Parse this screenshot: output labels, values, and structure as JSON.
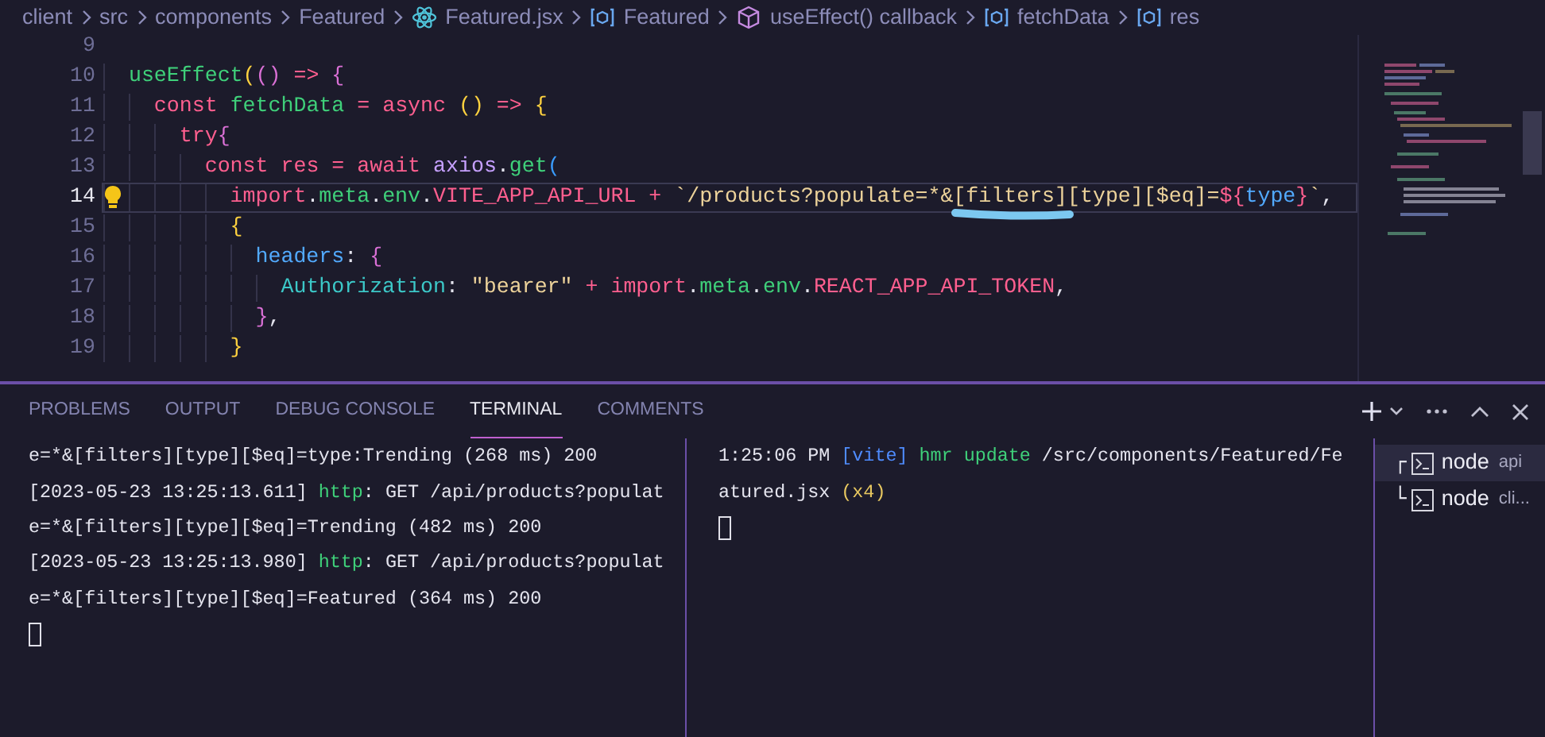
{
  "breadcrumb": [
    {
      "text": "client",
      "kind": "folder"
    },
    {
      "text": "src",
      "kind": "folder"
    },
    {
      "text": "components",
      "kind": "folder"
    },
    {
      "text": "Featured",
      "kind": "folder"
    },
    {
      "text": "Featured.jsx",
      "kind": "react"
    },
    {
      "text": "Featured",
      "kind": "variable"
    },
    {
      "text": "useEffect() callback",
      "kind": "method"
    },
    {
      "text": "fetchData",
      "kind": "variable"
    },
    {
      "text": "res",
      "kind": "variable"
    }
  ],
  "editor": {
    "lines": [
      {
        "number": "9",
        "current": false,
        "lightbulb": false
      },
      {
        "number": "10",
        "current": false,
        "lightbulb": false,
        "tokens": [
          {
            "text": "  useEffect",
            "kind": "fn"
          },
          {
            "text": "(",
            "kind": "b1"
          },
          {
            "text": "()",
            "kind": "b2"
          },
          {
            "text": " => ",
            "kind": "kw"
          },
          {
            "text": "{",
            "kind": "b2"
          }
        ]
      },
      {
        "number": "11",
        "current": false,
        "lightbulb": false,
        "tokens": [
          {
            "text": "    const ",
            "kind": "kw"
          },
          {
            "text": "fetchData",
            "kind": "fn"
          },
          {
            "text": " = ",
            "kind": "kw"
          },
          {
            "text": "async ",
            "kind": "kw"
          },
          {
            "text": "()",
            "kind": "b1"
          },
          {
            "text": " => ",
            "kind": "kw"
          },
          {
            "text": "{",
            "kind": "b1"
          }
        ]
      },
      {
        "number": "12",
        "current": false,
        "lightbulb": false,
        "tokens": [
          {
            "text": "      try",
            "kind": "kw"
          },
          {
            "text": "{",
            "kind": "b2"
          }
        ]
      },
      {
        "number": "13",
        "current": false,
        "lightbulb": false,
        "tokens": [
          {
            "text": "        const ",
            "kind": "kw"
          },
          {
            "text": "res",
            "kind": "kw"
          },
          {
            "text": " = ",
            "kind": "kw"
          },
          {
            "text": "await ",
            "kind": "kw"
          },
          {
            "text": "axios",
            "kind": "obj"
          },
          {
            "text": ".",
            "kind": "plain"
          },
          {
            "text": "get",
            "kind": "fn"
          },
          {
            "text": "(",
            "kind": "b3"
          }
        ]
      },
      {
        "number": "14",
        "current": true,
        "lightbulb": true,
        "tokens": [
          {
            "text": "          import",
            "kind": "kw"
          },
          {
            "text": ".",
            "kind": "plain"
          },
          {
            "text": "meta",
            "kind": "fn"
          },
          {
            "text": ".",
            "kind": "plain"
          },
          {
            "text": "env",
            "kind": "fn"
          },
          {
            "text": ".",
            "kind": "plain"
          },
          {
            "text": "VITE_APP_API_URL",
            "kind": "kw"
          },
          {
            "text": " + ",
            "kind": "kw"
          },
          {
            "text": "`/products?populate=*&[filters][type][$eq]=",
            "kind": "str"
          },
          {
            "text": "${",
            "kind": "kw"
          },
          {
            "text": "type",
            "kind": "prop"
          },
          {
            "text": "}",
            "kind": "kw"
          },
          {
            "text": "`",
            "kind": "str"
          },
          {
            "text": ",",
            "kind": "plain"
          }
        ]
      },
      {
        "number": "15",
        "current": false,
        "lightbulb": false,
        "tokens": [
          {
            "text": "          {",
            "kind": "b1"
          }
        ]
      },
      {
        "number": "16",
        "current": false,
        "lightbulb": false,
        "tokens": [
          {
            "text": "            headers",
            "kind": "prop"
          },
          {
            "text": ": ",
            "kind": "plain"
          },
          {
            "text": "{",
            "kind": "b2"
          }
        ]
      },
      {
        "number": "17",
        "current": false,
        "lightbulb": false,
        "tokens": [
          {
            "text": "              Authorization",
            "kind": "key"
          },
          {
            "text": ": ",
            "kind": "plain"
          },
          {
            "text": "\"bearer\"",
            "kind": "str"
          },
          {
            "text": " + ",
            "kind": "kw"
          },
          {
            "text": "import",
            "kind": "kw"
          },
          {
            "text": ".",
            "kind": "plain"
          },
          {
            "text": "meta",
            "kind": "fn"
          },
          {
            "text": ".",
            "kind": "plain"
          },
          {
            "text": "env",
            "kind": "fn"
          },
          {
            "text": ".",
            "kind": "plain"
          },
          {
            "text": "REACT_APP_API_TOKEN",
            "kind": "kw"
          },
          {
            "text": ",",
            "kind": "plain"
          }
        ]
      },
      {
        "number": "18",
        "current": false,
        "lightbulb": false,
        "tokens": [
          {
            "text": "            }",
            "kind": "b2"
          },
          {
            "text": ",",
            "kind": "plain"
          }
        ]
      },
      {
        "number": "19",
        "current": false,
        "lightbulb": false,
        "tokens": [
          {
            "text": "          }",
            "kind": "b1"
          }
        ]
      }
    ]
  },
  "panel": {
    "tabs": [
      {
        "label": "PROBLEMS",
        "selected": false
      },
      {
        "label": "OUTPUT",
        "selected": false
      },
      {
        "label": "DEBUG CONSOLE",
        "selected": false
      },
      {
        "label": "TERMINAL",
        "selected": true
      },
      {
        "label": "COMMENTS",
        "selected": false
      }
    ],
    "terminals": [
      {
        "lines": [
          {
            "kind": "output",
            "tokens": [
              {
                "text": "e=*&[filters][type][$eq]=type:Trending (268 ms) 200",
                "kind": "plain"
              }
            ]
          },
          {
            "kind": "output",
            "tokens": [
              {
                "text": "[2023-05-23 13:25:13.611] ",
                "kind": "plain"
              },
              {
                "text": "http",
                "kind": "green"
              },
              {
                "text": ": GET /api/products?populat",
                "kind": "plain"
              }
            ]
          },
          {
            "kind": "output",
            "tokens": [
              {
                "text": "e=*&[filters][type][$eq]=Trending (482 ms) 200",
                "kind": "plain"
              }
            ]
          },
          {
            "kind": "output",
            "tokens": [
              {
                "text": "[2023-05-23 13:25:13.980] ",
                "kind": "plain"
              },
              {
                "text": "http",
                "kind": "green"
              },
              {
                "text": ": GET /api/products?populat",
                "kind": "plain"
              }
            ]
          },
          {
            "kind": "output",
            "tokens": [
              {
                "text": "e=*&[filters][type][$eq]=Featured (364 ms) 200",
                "kind": "plain"
              }
            ]
          },
          {
            "kind": "cursor"
          }
        ]
      },
      {
        "lines": [
          {
            "kind": "output",
            "tokens": [
              {
                "text": "1:25:06 PM ",
                "kind": "plain"
              },
              {
                "text": "[vite]",
                "kind": "blue"
              },
              {
                "text": " hmr update",
                "kind": "green"
              },
              {
                "text": " /src/components/Featured/Fe",
                "kind": "plain"
              }
            ]
          },
          {
            "kind": "output",
            "tokens": [
              {
                "text": "atured.jsx ",
                "kind": "plain"
              },
              {
                "text": "(x4)",
                "kind": "yellow"
              }
            ]
          },
          {
            "kind": "cursor"
          }
        ]
      }
    ],
    "terminal_list": [
      {
        "bracket": "┌",
        "name": "node",
        "detail": "api",
        "selected": true
      },
      {
        "bracket": "└",
        "name": "node",
        "detail": "cli...",
        "selected": false
      }
    ]
  }
}
